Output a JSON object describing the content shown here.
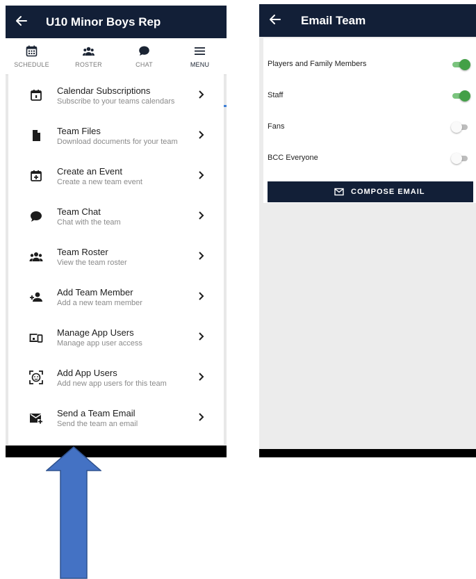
{
  "left_screen": {
    "header": {
      "title": "U10 Minor Boys Rep"
    },
    "tabs": [
      {
        "label": "SCHEDULE",
        "icon": "calendar-grid-icon",
        "active": false
      },
      {
        "label": "ROSTER",
        "icon": "group-icon",
        "active": false
      },
      {
        "label": "CHAT",
        "icon": "chat-bubble-icon",
        "active": false
      },
      {
        "label": "MENU",
        "icon": "hamburger-icon",
        "active": true
      }
    ],
    "menu": [
      {
        "title": "Calendar Subscriptions",
        "subtitle": "Subscribe to your teams calendars",
        "icon": "calendar-icon"
      },
      {
        "title": "Team Files",
        "subtitle": "Download documents for your team",
        "icon": "file-icon"
      },
      {
        "title": "Create an Event",
        "subtitle": "Create a new team event",
        "icon": "calendar-add-icon"
      },
      {
        "title": "Team Chat",
        "subtitle": "Chat with the team",
        "icon": "chat-bubble-icon"
      },
      {
        "title": "Team Roster",
        "subtitle": "View the team roster",
        "icon": "group-icon"
      },
      {
        "title": "Add Team Member",
        "subtitle": "Add a new team member",
        "icon": "person-add-icon"
      },
      {
        "title": "Manage App Users",
        "subtitle": "Manage app user access",
        "icon": "devices-icon"
      },
      {
        "title": "Add App Users",
        "subtitle": "Add new app users for this team",
        "icon": "face-scan-icon"
      },
      {
        "title": "Send a Team Email",
        "subtitle": "Send the team an email",
        "icon": "email-plus-icon"
      }
    ]
  },
  "right_screen": {
    "header": {
      "title": "Email Team"
    },
    "recipients": [
      {
        "label": "Players and Family Members",
        "enabled": true
      },
      {
        "label": "Staff",
        "enabled": true
      },
      {
        "label": "Fans",
        "enabled": false
      },
      {
        "label": "BCC Everyone",
        "enabled": false
      }
    ],
    "compose_button": {
      "label": "COMPOSE EMAIL",
      "icon": "email-outline-icon"
    }
  },
  "colors": {
    "header_bg": "#121f37",
    "toggle_on": "#43a047",
    "tab_underline": "#3f7fd6",
    "arrow_fill": "#4472c4",
    "arrow_stroke": "#2f528f"
  }
}
